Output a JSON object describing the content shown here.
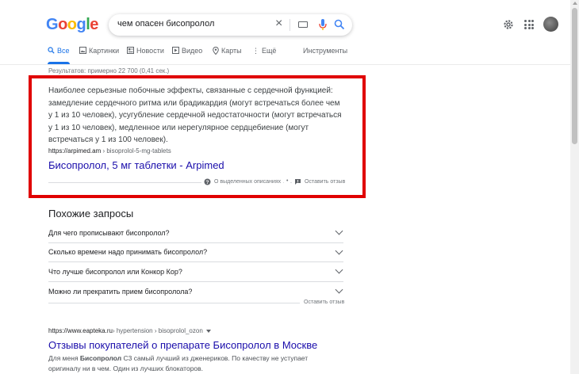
{
  "logo": {
    "letters": [
      "G",
      "o",
      "o",
      "g",
      "l",
      "e"
    ],
    "colors": [
      "#4285f4",
      "#ea4335",
      "#fbbc05",
      "#4285f4",
      "#34a853",
      "#ea4335"
    ]
  },
  "search": {
    "query": "чем опасен бисопролол"
  },
  "tabs": [
    {
      "label": "Все",
      "icon": "search-icon",
      "active": true
    },
    {
      "label": "Картинки",
      "icon": "image-icon"
    },
    {
      "label": "Новости",
      "icon": "news-icon"
    },
    {
      "label": "Видео",
      "icon": "video-icon"
    },
    {
      "label": "Карты",
      "icon": "map-pin-icon"
    },
    {
      "label": "Ещё",
      "icon": "more-icon"
    }
  ],
  "tools_label": "Инструменты",
  "stats": "Результатов: примерно 22 700 (0,41 сек.)",
  "featured_snippet": {
    "text": "Наиболее серьезные побочные эффекты, связанные с сердечной функцией: замедление сердечного ритма или брадикардия (могут встречаться более чем у 1 из 10 человек), усугубление сердечной недостаточности (могут встречаться у 1 из 10 человек), медленное или нерегулярное сердцебиение (могут встречаться у 1 из 100 человек).",
    "url_domain": "https://arpimed.am",
    "url_path": " › bisoprolol-5-mg-tablets",
    "title": "Бисопролол, 5 мг таблетки - Arpimed",
    "about_label": "О выделенных описаниях",
    "dot": "•",
    "feedback_label": "Оставить отзыв",
    "highlight_color": "#e00000"
  },
  "related": {
    "title": "Похожие запросы",
    "items": [
      "Для чего прописывают бисопролол?",
      "Сколько времени надо принимать бисопролол?",
      "Что лучше бисопролол или Конкор Кор?",
      "Можно ли прекратить прием бисопролола?"
    ],
    "feedback_label": "Оставить отзыв"
  },
  "result2": {
    "url_domain": "https://www.eapteka.ru",
    "url_path": " › hypertension › bisoprolol_ozon",
    "title": "Отзывы покупателей о препарате Бисопролол в Москве",
    "desc_before": "Для меня ",
    "desc_bold": "Бисопролол",
    "desc_after": " С3 самый лучший из дженериков. По качеству не уступает оригиналу ни в чем. Один из лучших блокаторов."
  }
}
